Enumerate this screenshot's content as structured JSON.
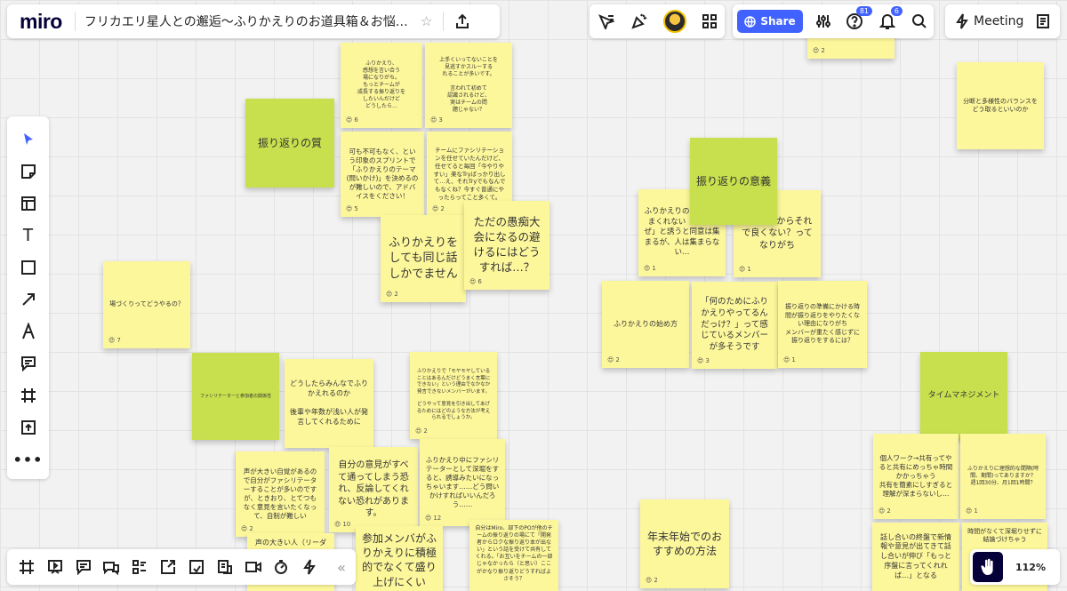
{
  "app": {
    "logo": "miro",
    "board_title": "フリカエリ星人との邂逅〜ふりかえりのお道具箱＆お悩…"
  },
  "topbar": {
    "share_label": "Share",
    "help_badge": "81",
    "notif_badge": "6",
    "meeting_label": "Meeting"
  },
  "zoom": {
    "level": "112%"
  },
  "stickies": [
    {
      "text": "ふりかえり、\n感想を言い合う\n場になりがち。\nもっとチームが\n成長する振り返りを\nしたいんだけど\nどうしたら…",
      "react": "6"
    },
    {
      "text": "上手くいってないことを\n見逃すかスルーする\nれることが多いです。\n\n言われて初めて\n認識されるけど、\n実はチームの問\n題じゃない？",
      "react": "3"
    },
    {
      "text": "振り返りの質",
      "react": ""
    },
    {
      "text": "可も不可もなく、という印象のスプリントで「ふりかえりのテーマ(問いかけ)」を決めるのが難しいので、アドバイスをください！",
      "react": "5"
    },
    {
      "text": "チームにファシリテーションを任せていたんだけど、任せてると毎回「今やりやすい」楽なTryばっかり出して…え、それTryでもなんでもなくね？今すぐ普通にやったらってこと多くて。",
      "react": "2"
    },
    {
      "text": "ふりかえりをしても同じ話しかでません",
      "react": "2"
    },
    {
      "text": "ただの愚痴大会になるの避けるにはどうすれば…？",
      "react": "6"
    },
    {
      "text": "場づくりってどうやるの？",
      "react": "7"
    },
    {
      "text": "ファシリテーターと参加者の関係性",
      "react": ""
    },
    {
      "text": "どうしたらみんなでふりかえれるのか\n\n後輩や年数が浅い人が発言してくれるために",
      "react": ""
    },
    {
      "text": "ふりかえりで「モヤモヤしていることはあるんだけどうまく言葉にできない」という理由でなかなか発言できないメンバーがいます。\n\nどうやって意見を引き出してあげるためにはどのような方法が考えられるでしょうか。",
      "react": "2"
    },
    {
      "text": "声が大きい自覚があるので自分がファシリテーターすることが多いのですが、ときおり、とてつもなく意見を言いたくなって、自制が難しい",
      "react": "2"
    },
    {
      "text": "自分の意見がすべて通ってしまう恐れ、反論してくれない恐れがあります。",
      "react": "10"
    },
    {
      "text": "ふりかえり中にファシリテーターとして深堀をすると、誘導みたいになっちゃいます……どう問いかけすればいいんだろう……",
      "react": "12"
    },
    {
      "text": "声の大きい人（リーダー",
      "react": ""
    },
    {
      "text": "参加メンバがふりかえりに積極的でなくて盛り上げにくい",
      "react": ""
    },
    {
      "text": "自分はMiro、部下のPOが他のチームの振り返りの場にて「開発者からロクな振り返り本が出ない」という話を受けて共有してくれる。「お互いをチームの一部じゃなかったら（と思い）ここがかなり振り返りどうすればよさそう？",
      "react": ""
    },
    {
      "text": "ふりかえりのしさをうまくれない「やろうぜ」と誘うと同意は集まるが、人は集まらない…",
      "react": "1"
    },
    {
      "text": "振り返りの意義",
      "react": ""
    },
    {
      "text": "KPTいるからそれで良くない？ってなりがち",
      "react": "1"
    },
    {
      "text": "ふりかえりの始め方",
      "react": "2"
    },
    {
      "text": "「何のためにふりかえりやってるんだっけ？」って感じているメンバーが多そうです",
      "react": "3"
    },
    {
      "text": "振り返りの準備にかける時間が振り返りをやりたくない理由になりがち\nメンバーが重たく感じずに振り返りをするには？",
      "react": "1"
    },
    {
      "text": "年末年始でのおすすめの方法",
      "react": "2"
    },
    {
      "text": "分断と多様性のバランスをどう取るといいのか",
      "react": ""
    },
    {
      "text": "タイムマネジメント",
      "react": ""
    },
    {
      "text": "個人ワーク→共有ってやると共有にめっちゃ時間かかっちゃう\n共有を簡素にしすぎると理解が深まらないし…",
      "react": "2"
    },
    {
      "text": "ふりかえりに理想的な間隔(時間、期間)ってありますか？\n週1回30分、月1回1時間？",
      "react": "1"
    },
    {
      "text": "話し合いの終盤で新情報や意見が出てきて話し合いが伸び「もっと序盤に言ってくれれば…」となる",
      "react": ""
    },
    {
      "text": "時間がなくて深堀りせずに結論づけちゃう",
      "react": ""
    },
    {
      "text": "",
      "react": "2"
    }
  ]
}
